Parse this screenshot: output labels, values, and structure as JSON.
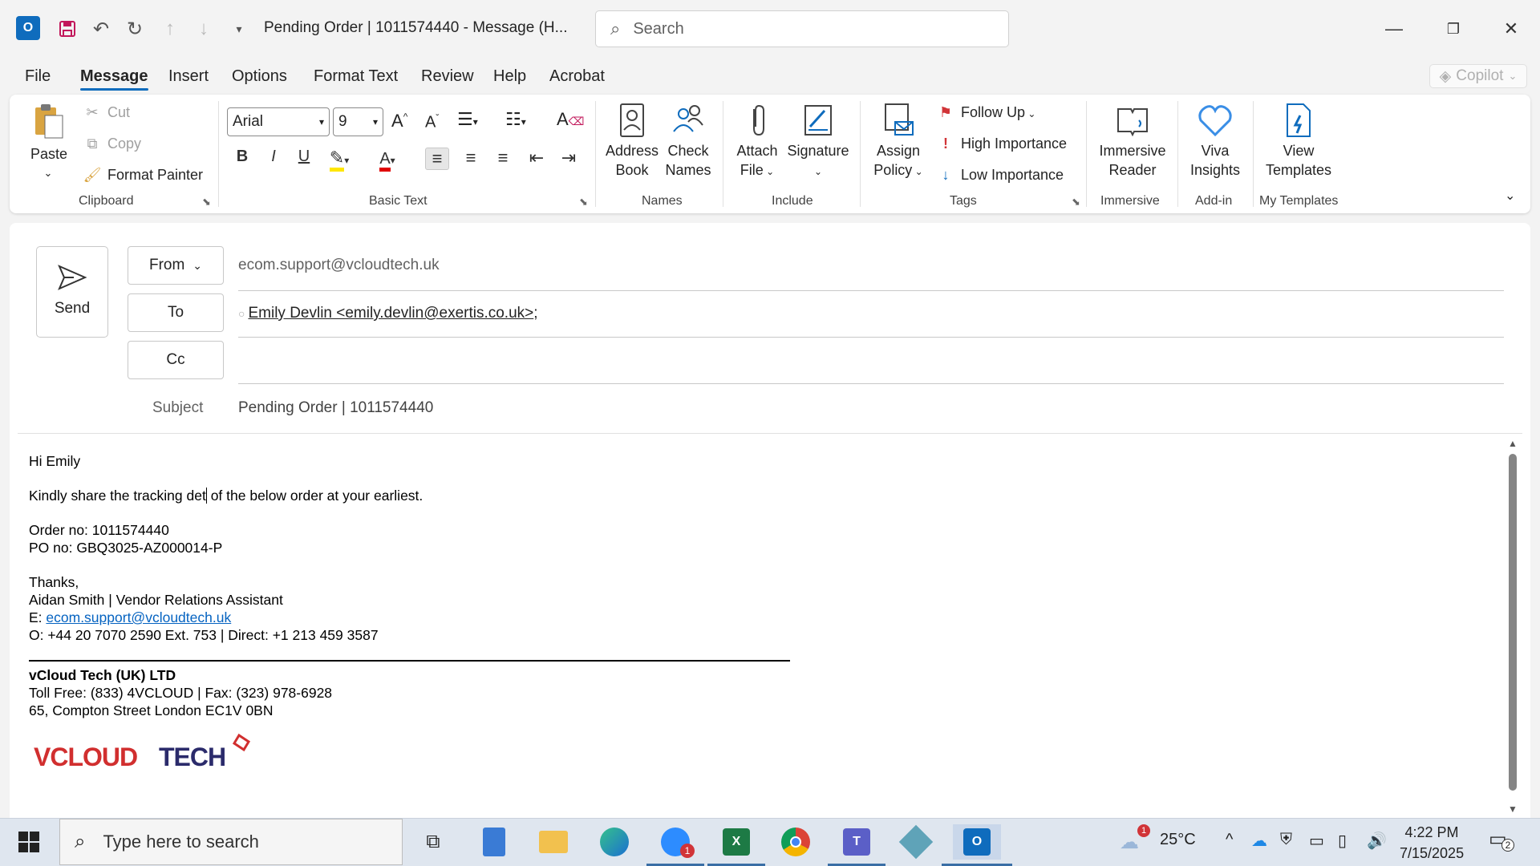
{
  "titlebar": {
    "title": "Pending Order |  1011574440  -  Message (H...",
    "search_placeholder": "Search"
  },
  "menu": {
    "tabs": [
      "File",
      "Message",
      "Insert",
      "Options",
      "Format Text",
      "Review",
      "Help",
      "Acrobat"
    ],
    "active": "Message",
    "copilot": "Copilot"
  },
  "ribbon": {
    "clipboard": {
      "paste": "Paste",
      "cut": "Cut",
      "copy": "Copy",
      "format_painter": "Format Painter",
      "label": "Clipboard"
    },
    "basic_text": {
      "font": "Arial",
      "size": "9",
      "label": "Basic Text"
    },
    "names": {
      "address_book_1": "Address",
      "address_book_2": "Book",
      "check_names_1": "Check",
      "check_names_2": "Names",
      "label": "Names"
    },
    "include": {
      "attach_1": "Attach",
      "attach_2": "File",
      "signature": "Signature",
      "label": "Include"
    },
    "tags": {
      "assign_1": "Assign",
      "assign_2": "Policy",
      "follow_up": "Follow Up",
      "high": "High Importance",
      "low": "Low Importance",
      "label": "Tags"
    },
    "immersive": {
      "reader_1": "Immersive",
      "reader_2": "Reader",
      "label": "Immersive"
    },
    "addin": {
      "viva_1": "Viva",
      "viva_2": "Insights",
      "label": "Add-in"
    },
    "templates": {
      "view_1": "View",
      "view_2": "Templates",
      "label": "My Templates"
    }
  },
  "compose": {
    "send": "Send",
    "from_label": "From",
    "from_value": "ecom.support@vcloudtech.uk",
    "to_label": "To",
    "to_value": "Emily Devlin <emily.devlin@exertis.co.uk>",
    "to_suffix": ";",
    "cc_label": "Cc",
    "subject_label": "Subject",
    "subject_value": "Pending Order |  1011574440"
  },
  "body": {
    "greeting": "Hi Emily",
    "line1_a": "Kindly share the tracking det",
    "line1_b": " of the below order at your earliest.",
    "order_no": "Order no: 1011574440",
    "po_no": "PO no: GBQ3025-AZ000014-P",
    "thanks": "Thanks,",
    "sender": "Aidan Smith | Vendor Relations Assistant",
    "email_prefix": "E: ",
    "email": "ecom.support@vcloudtech.uk",
    "phone": "O:  +44 20 7070 2590 Ext. 753 | Direct: +1 213 459 3587",
    "company": "vCloud Tech (UK) LTD",
    "tollfree": "Toll Free: (833) 4VCLOUD | Fax: (323) 978-6928",
    "address": "65, Compton Street London EC1V 0BN",
    "logo_text": "VCLOUD TECH"
  },
  "taskbar": {
    "search_placeholder": "Type here to search",
    "weather": "25°C",
    "weather_badge": "1",
    "zoom_badge": "1",
    "time": "4:22 PM",
    "date": "7/15/2025",
    "notif_count": "2"
  },
  "colors": {
    "accent": "#0f6cbd",
    "link": "#0563c1"
  }
}
